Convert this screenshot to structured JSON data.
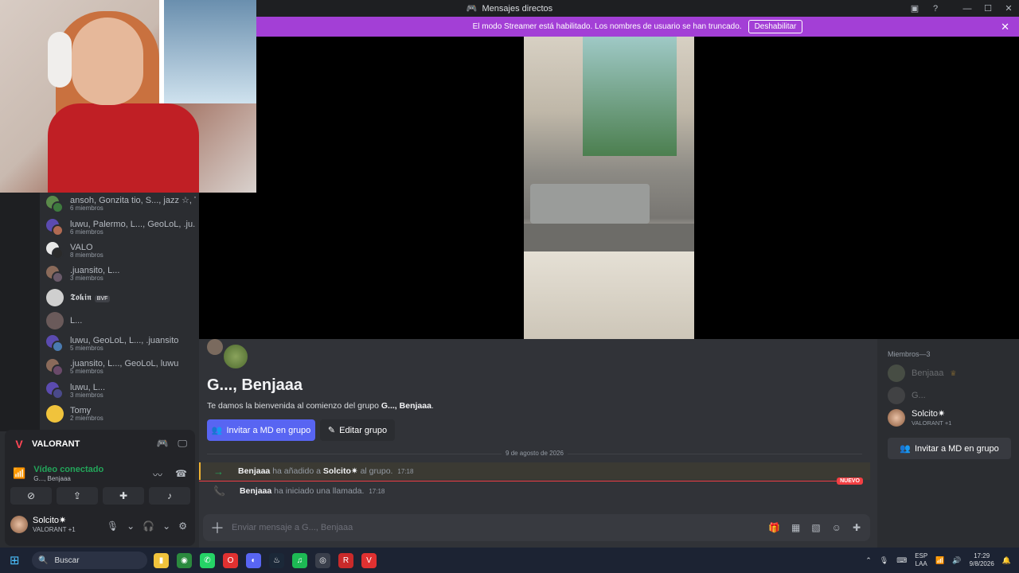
{
  "window": {
    "title": "Mensajes directos",
    "controls": [
      "inbox-icon",
      "help-icon",
      "minimize-icon",
      "maximize-icon",
      "close-icon"
    ]
  },
  "streamer_banner": {
    "text": "El modo Streamer está habilitado. Los nombres de usuario se han truncado.",
    "button": "Deshabilitar"
  },
  "dm_list": [
    {
      "name": "ansoh, Gonzita tio, S..., jazz ☆, T...",
      "sub": "6 miembros"
    },
    {
      "name": "luwu, Palermo, L..., GeoLoL, .ju...",
      "sub": "6 miembros"
    },
    {
      "name": "VALO",
      "sub": "8 miembros"
    },
    {
      "name": ".juansito, L...",
      "sub": "3 miembros"
    },
    {
      "name": "𝕿𝖔𝖐𝖎𝖓",
      "sub": "",
      "tag": "BVF"
    },
    {
      "name": "L...",
      "sub": ""
    },
    {
      "name": "luwu, GeoLoL, L..., .juansito",
      "sub": "5 miembros"
    },
    {
      "name": ".juansito, L..., GeoLoL, luwu",
      "sub": "5 miembros"
    },
    {
      "name": "luwu, L...",
      "sub": "3 miembros"
    },
    {
      "name": "Tomy",
      "sub": "2 miembros"
    }
  ],
  "voice_panel": {
    "game": "VALORANT",
    "status": "Vídeo conectado",
    "channel": "G..., Benjaaa",
    "user_name": "Solcito✷",
    "user_status": "VALORANT +1"
  },
  "chat": {
    "group_title": "G..., Benjaaa",
    "welcome_prefix": "Te damos la bienvenida al comienzo del grupo ",
    "welcome_group": "G..., Benjaaa",
    "welcome_suffix": ".",
    "invite_button": "Invitar a MD en grupo",
    "edit_button": "Editar grupo",
    "date_separator": "9 de agosto de 2026",
    "messages": [
      {
        "user": "Benjaaa",
        "action": "ha añadido a",
        "target": "Solcito✷",
        "suffix": "al grupo.",
        "time": "17:18"
      },
      {
        "user": "Benjaaa",
        "action": "ha iniciado una llamada.",
        "time": "17:18"
      }
    ],
    "new_badge": "NUEVO",
    "composer_placeholder": "Enviar mensaje a G..., Benjaaa"
  },
  "members": {
    "header": "Miembros—3",
    "list": [
      {
        "name": "Benjaaa",
        "status": ""
      },
      {
        "name": "G...",
        "status": ""
      },
      {
        "name": "Solcito✷",
        "status": "VALORANT +1"
      }
    ],
    "invite_button": "Invitar a MD en grupo"
  },
  "taskbar": {
    "search": "Buscar",
    "lang_top": "ESP",
    "lang_bottom": "LAA",
    "time": "17:29",
    "date": "9/8/2026"
  },
  "colors": {
    "banner": "#a33fd6",
    "blurple": "#5865f2",
    "green": "#23a55a",
    "new_red": "#f23f43"
  }
}
